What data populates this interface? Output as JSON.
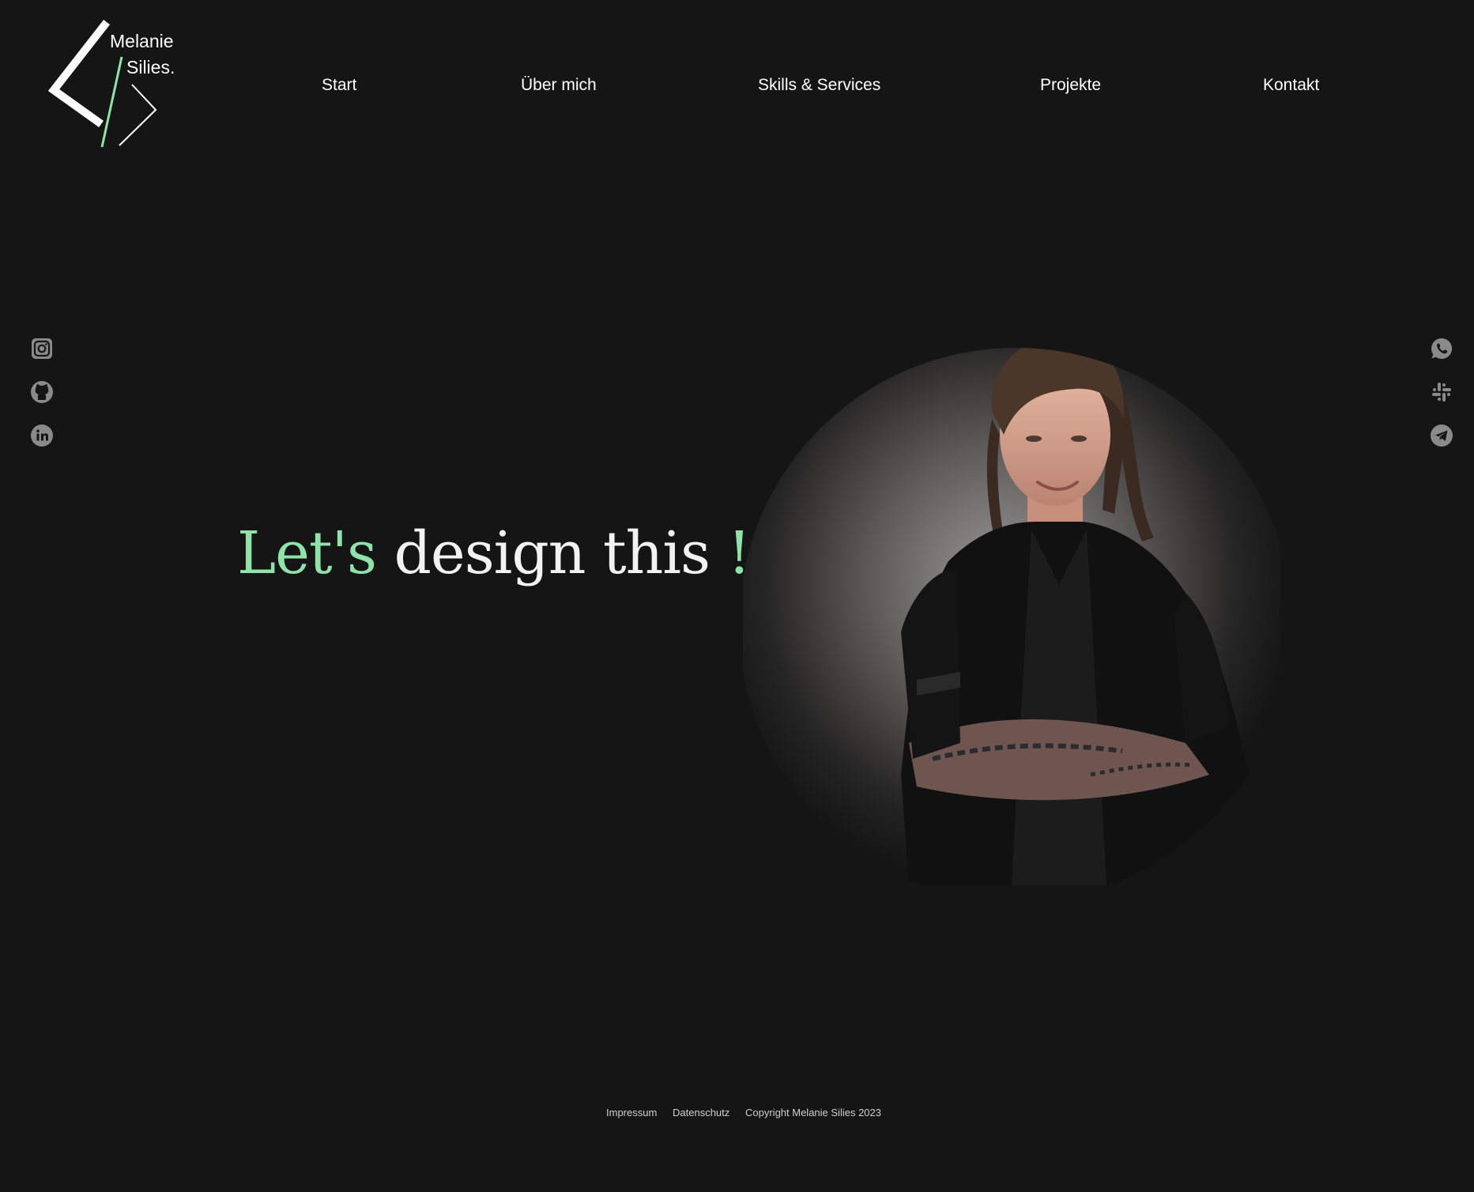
{
  "brand": {
    "first_name": "Melanie",
    "last_name": "Silies.",
    "accent_color": "#8ee3a9"
  },
  "nav": {
    "items": [
      {
        "label": "Start"
      },
      {
        "label": "Über mich"
      },
      {
        "label": "Skills & Services"
      },
      {
        "label": "Projekte"
      },
      {
        "label": "Kontakt"
      }
    ]
  },
  "hero": {
    "headline_accent": "Let's",
    "headline_main": "design this",
    "headline_end": "!",
    "portrait_icon": "portrait-photo"
  },
  "social_left": [
    {
      "icon": "instagram-icon"
    },
    {
      "icon": "github-icon"
    },
    {
      "icon": "linkedin-icon"
    }
  ],
  "social_right": [
    {
      "icon": "whatsapp-icon"
    },
    {
      "icon": "slack-icon"
    },
    {
      "icon": "telegram-icon"
    }
  ],
  "footer": {
    "impressum": "Impressum",
    "datenschutz": "Datenschutz",
    "copyright": "Copyright Melanie Silies 2023"
  },
  "colors": {
    "background": "#151515",
    "text": "#ffffff",
    "icon_gray": "#8a8a8a"
  }
}
